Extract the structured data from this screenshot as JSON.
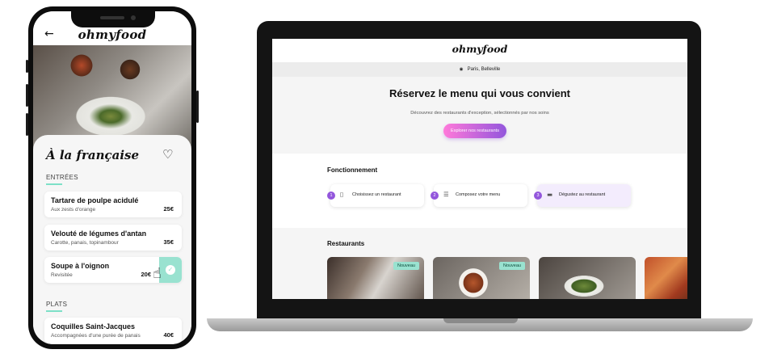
{
  "phone": {
    "logo": "ohmyfood",
    "back_icon": "←",
    "restaurant_title": "À la française",
    "heart_icon": "♡",
    "sections": [
      {
        "label": "ENTRÉES"
      },
      {
        "label": "PLATS"
      }
    ],
    "dishes": [
      {
        "name": "Tartare de poulpe acidulé",
        "desc": "Aux zests d'orange",
        "price": "25€"
      },
      {
        "name": "Velouté de légumes d'antan",
        "desc": "Carotte, panais, topinambour",
        "price": "35€"
      },
      {
        "name": "Soupe à l'oignon",
        "desc": "Revisitée",
        "price": "20€"
      },
      {
        "name": "Coquilles Saint-Jacques",
        "desc": "Accompagnées d'une purée de panais",
        "price": "40€"
      }
    ]
  },
  "laptop": {
    "logo": "ohmyfood",
    "location": "Paris, Belleville",
    "location_icon": "📍",
    "hero_title": "Réservez le menu qui vous convient",
    "hero_subtitle": "Découvrez des restaurants d'exception, sélectionnés par nos soins",
    "cta_label": "Explorer nos restaurants",
    "how_title": "Fonctionnement",
    "steps": [
      {
        "num": "1",
        "icon": "▯",
        "label": "Choisissez un restaurant"
      },
      {
        "num": "2",
        "icon": "☰",
        "label": "Composez votre menu"
      },
      {
        "num": "3",
        "icon": "▬",
        "label": "Dégustez au restaurant"
      }
    ],
    "restaurants_title": "Restaurants",
    "restaurants": [
      {
        "badge": "Nouveau"
      },
      {
        "badge": "Nouveau"
      },
      {
        "badge": ""
      },
      {
        "badge": ""
      }
    ]
  },
  "colors": {
    "accent_mint": "#99e2d0",
    "gradient_pink": "#ff79da",
    "gradient_purple": "#9356dc"
  }
}
